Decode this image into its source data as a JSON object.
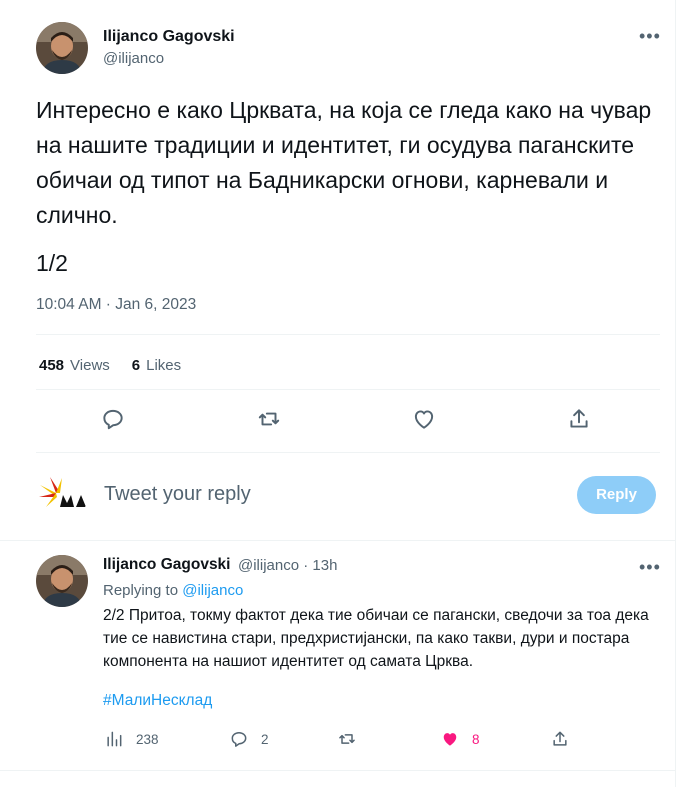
{
  "main_tweet": {
    "author_name": "Ilijanco Gagovski",
    "author_handle": "@ilijanco",
    "text": "Интересно е како Црквата, на која се гледа како на чувар на нашите традиции и идентитет, ги осудува паганските обичаи од типот на Бадникарски огнови, карневали и слично.",
    "part": "1/2",
    "timestamp": "10:04 AM · Jan 6, 2023",
    "views_count": "458",
    "views_label": "Views",
    "likes_count": "6",
    "likes_label": "Likes",
    "more_icon": "more-icon"
  },
  "reply_box": {
    "placeholder": "Tweet your reply",
    "button_label": "Reply",
    "button_color": "#8ecdf8"
  },
  "reply_tweet": {
    "author_name": "Ilijanco Gagovski",
    "meta": "@ilijanco · 13h",
    "replying_prefix": "Replying to",
    "replying_handle": "@ilijanco",
    "text": "2/2 Притоа, токму фактот дека тие обичаи се пагански, сведочи за тоа дека тие се навистина стари, предхристијански, па како такви, дури и постара компонента на нашиот идентитет од самата Црква.",
    "hashtag": "#МалиНесклад",
    "views": "238",
    "replies": "2",
    "likes": "8",
    "like_color": "#f91880"
  },
  "colors": {
    "accent": "#1d9bf0",
    "secondary_text": "#536471",
    "divider": "#eff3f4"
  }
}
